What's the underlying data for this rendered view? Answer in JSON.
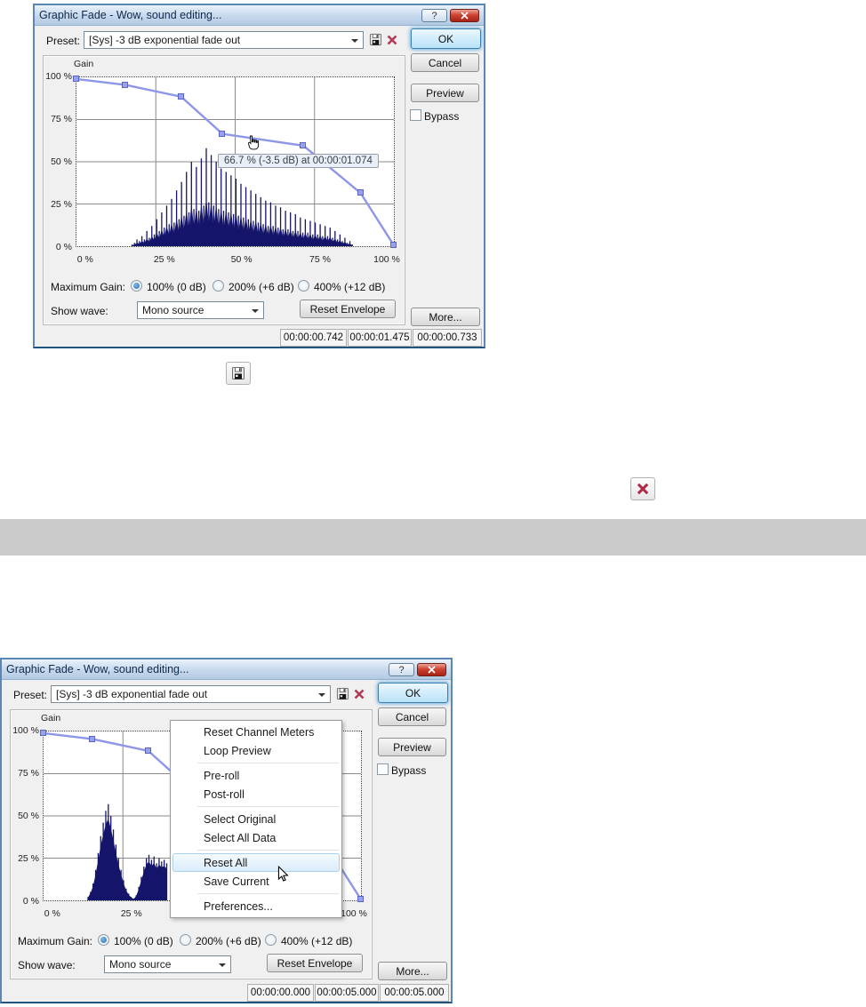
{
  "shared": {
    "title": "Graphic Fade - Wow, sound editing...",
    "help_glyph": "?",
    "preset_label": "Preset:",
    "preset_value": "[Sys]  -3 dB exponential fade out",
    "ok": "OK",
    "cancel": "Cancel",
    "preview": "Preview",
    "bypass": "Bypass",
    "gain_label": "Gain",
    "y_ticks": [
      "100 %",
      "75 %",
      "50 %",
      "25 %",
      "0 %"
    ],
    "x_ticks": [
      "0 %",
      "25 %",
      "50 %",
      "75 %",
      "100 %"
    ],
    "max_gain_label": "Maximum Gain:",
    "radios": [
      "100% (0 dB)",
      "200% (+6 dB)",
      "400% (+12 dB)"
    ],
    "selected_radio_index": 0,
    "show_wave_label": "Show wave:",
    "show_wave_value": "Mono source",
    "reset_envelope": "Reset Envelope",
    "more": "More...",
    "colors": {
      "envelope": "#8d96e8",
      "waveform": "#15156b",
      "grid": "#8a8a8a",
      "menu_highlight": "#d9ecfa",
      "titlebar": "#c6d8ec"
    }
  },
  "dialog1": {
    "tooltip": "66.7 % (-3.5 dB) at 00:00:01.074",
    "status_cells": [
      "00:00:00.742",
      "00:00:01.475",
      "00:00:00.733"
    ],
    "envelope_points": [
      [
        0,
        99
      ],
      [
        15.5,
        95.5
      ],
      [
        33,
        88.5
      ],
      [
        46,
        66.5
      ],
      [
        71.5,
        59.5
      ],
      [
        89.5,
        31.5
      ],
      [
        100,
        0.5
      ]
    ],
    "waveform": {
      "x_start": 17.5,
      "x_step": 0.78,
      "fill_factor": 0.5,
      "heights": [
        1,
        2,
        4,
        3,
        6,
        4,
        9,
        5,
        12,
        7,
        16,
        9,
        20,
        11,
        24,
        13,
        28,
        14,
        33,
        16,
        38,
        18,
        44,
        20,
        50,
        22,
        47,
        21,
        52,
        24,
        58,
        26,
        54,
        24,
        50,
        22,
        46,
        21,
        44,
        20,
        42,
        19,
        40,
        18,
        37,
        17,
        35,
        16,
        33,
        15,
        31,
        14,
        29,
        13,
        27,
        12,
        26,
        12,
        24,
        11,
        23,
        10,
        21,
        10,
        20,
        9,
        19,
        9,
        17,
        8,
        16,
        8,
        15,
        7,
        14,
        7,
        13,
        6,
        12,
        6,
        11,
        5,
        9,
        4,
        7,
        3,
        5,
        2,
        3,
        1
      ]
    }
  },
  "dialog2": {
    "status_cells": [
      "00:00:00.000",
      "00:00:05.000",
      "00:00:05.000"
    ],
    "envelope_points": [
      [
        0,
        99
      ],
      [
        15.5,
        95.5
      ],
      [
        33,
        88.5
      ],
      [
        46,
        66.5
      ],
      [
        71.5,
        59.5
      ],
      [
        89.5,
        31.5
      ],
      [
        100,
        0.5
      ]
    ],
    "waveform": {
      "x_start": 14,
      "x_step": 0.8,
      "fill_factor": 0.85,
      "heights": [
        2,
        5,
        10,
        18,
        28,
        38,
        46,
        53,
        57,
        50,
        42,
        33,
        25,
        18,
        12,
        7,
        4,
        2,
        1,
        3,
        8,
        14,
        20,
        25,
        27,
        24,
        26,
        22,
        25,
        23,
        24,
        22
      ]
    },
    "context_menu": {
      "items": [
        "Reset Channel Meters",
        "Loop Preview",
        "Pre-roll",
        "Post-roll",
        "Select Original",
        "Select All Data",
        "Reset All",
        "Save Current",
        "Preferences..."
      ],
      "highlighted_item": "Reset All"
    }
  }
}
